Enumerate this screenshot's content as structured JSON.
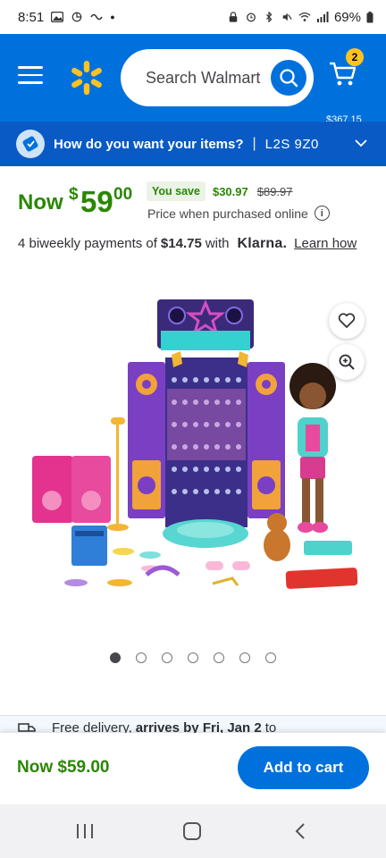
{
  "status_bar": {
    "time": "8:51",
    "battery": "69%"
  },
  "header": {
    "search_placeholder": "Search Walmart",
    "cart_count": "2",
    "cart_total": "$367.15",
    "colors": {
      "primary": "#0071dc",
      "spark": "#ffc220"
    }
  },
  "fulfillment": {
    "question": "How do you want your items?",
    "separator": "|",
    "zip": "L2S 9Z0"
  },
  "price": {
    "now_label": "Now",
    "currency": "$",
    "dollars": "59",
    "cents": "00",
    "you_save_label": "You save",
    "save_amount": "$30.97",
    "was_price": "$89.97",
    "price_note": "Price when purchased online",
    "green": "#2a8703"
  },
  "klarna": {
    "prefix": "4 biweekly payments of",
    "amount": "$14.75",
    "with": "with",
    "brand": "Klarna.",
    "learn_more": "Learn how"
  },
  "gallery": {
    "image_count": 7,
    "active_index": 0
  },
  "delivery": {
    "text_a": "Free delivery,",
    "text_b": "arrives by Fri, Jan 2",
    "text_c": "to"
  },
  "footer": {
    "price": "Now $59.00",
    "add_to_cart": "Add to cart"
  }
}
